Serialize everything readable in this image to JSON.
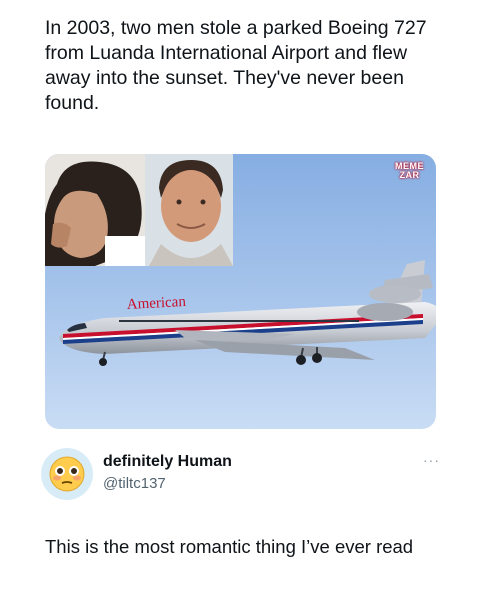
{
  "post": {
    "text": "In 2003, two men stole a parked Boeing 727 from Luanda International Airport and flew away into the sunset. They've never been found."
  },
  "media": {
    "watermark_line1": "MEME",
    "watermark_line2": "ZAR",
    "plane_livery_text": "American",
    "watermark_color": "#c0102a",
    "sky_color": "#9dbde8"
  },
  "reply": {
    "display_name": "definitely Human",
    "handle": "@tiltc137",
    "avatar_icon": "flushed-face-emoji",
    "more_icon": "ellipsis-icon",
    "more_glyph": "···",
    "text": "This is the most romantic thing I’ve ever read"
  }
}
